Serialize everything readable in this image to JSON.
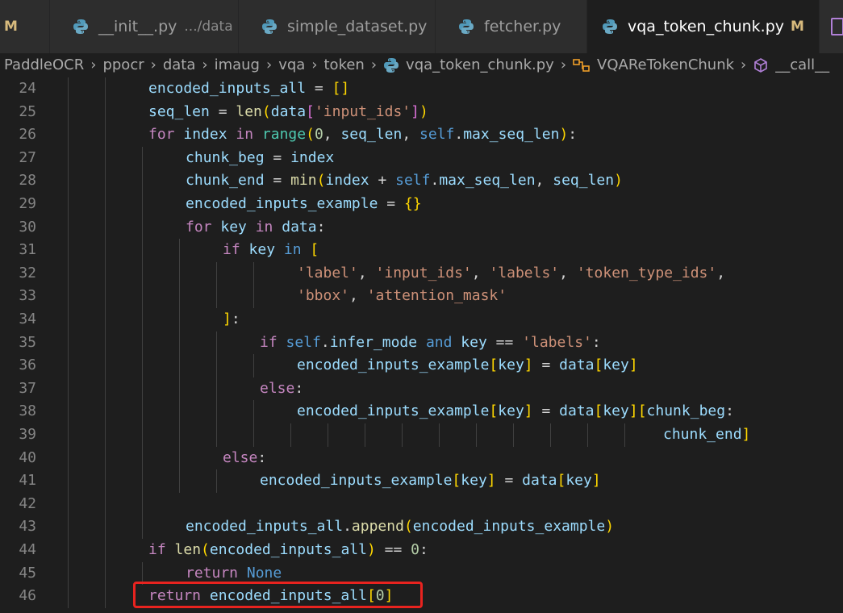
{
  "tabs": [
    {
      "label": "",
      "modified": "M",
      "active": false,
      "kind": "partial"
    },
    {
      "label": "__init__.py",
      "description": ".../data",
      "active": false,
      "kind": "python"
    },
    {
      "label": "simple_dataset.py",
      "active": false,
      "kind": "python"
    },
    {
      "label": "fetcher.py",
      "active": false,
      "kind": "python"
    },
    {
      "label": "vqa_token_chunk.py",
      "modified": "M",
      "active": true,
      "kind": "python"
    },
    {
      "label": "",
      "active": false,
      "kind": "preview"
    }
  ],
  "icons": {
    "python": "python-file-icon",
    "class": "class-symbol-icon",
    "method": "method-symbol-icon",
    "close": "close-icon",
    "chevron": "chevron-right-icon",
    "close_glyph": "✕",
    "chevron_glyph": "›"
  },
  "colors": {
    "highlight_box": "#e8231f",
    "accent_modified": "#d7ba7d"
  },
  "breadcrumb": [
    {
      "label": "PaddleOCR"
    },
    {
      "label": "ppocr"
    },
    {
      "label": "data"
    },
    {
      "label": "imaug"
    },
    {
      "label": "vqa"
    },
    {
      "label": "token"
    },
    {
      "label": "vqa_token_chunk.py",
      "icon": "python"
    },
    {
      "label": "VQAReTokenChunk",
      "icon": "class"
    },
    {
      "label": "__call__",
      "icon": "method"
    }
  ],
  "editor": {
    "lines": [
      {
        "n": "24",
        "indent": 2,
        "tokens": [
          [
            "c0",
            "encoded_inputs_all"
          ],
          [
            "op",
            " = "
          ],
          [
            "b1",
            "[]"
          ]
        ]
      },
      {
        "n": "25",
        "indent": 2,
        "tokens": [
          [
            "c0",
            "seq_len"
          ],
          [
            "op",
            " = "
          ],
          [
            "fn",
            "len"
          ],
          [
            "b1",
            "("
          ],
          [
            "c0",
            "data"
          ],
          [
            "b2",
            "["
          ],
          [
            "str",
            "'input_ids'"
          ],
          [
            "b2",
            "]"
          ],
          [
            "b1",
            ")"
          ]
        ]
      },
      {
        "n": "26",
        "indent": 2,
        "tokens": [
          [
            "kw",
            "for"
          ],
          [
            "c0",
            " index "
          ],
          [
            "kw",
            "in"
          ],
          [
            "op",
            " "
          ],
          [
            "cls",
            "range"
          ],
          [
            "b1",
            "("
          ],
          [
            "num",
            "0"
          ],
          [
            "op",
            ", "
          ],
          [
            "c0",
            "seq_len"
          ],
          [
            "op",
            ", "
          ],
          [
            "kwb",
            "self"
          ],
          [
            "op",
            "."
          ],
          [
            "c0",
            "max_seq_len"
          ],
          [
            "b1",
            ")"
          ],
          [
            "op",
            ":"
          ]
        ]
      },
      {
        "n": "27",
        "indent": 3,
        "tokens": [
          [
            "c0",
            "chunk_beg"
          ],
          [
            "op",
            " = "
          ],
          [
            "c0",
            "index"
          ]
        ]
      },
      {
        "n": "28",
        "indent": 3,
        "tokens": [
          [
            "c0",
            "chunk_end"
          ],
          [
            "op",
            " = "
          ],
          [
            "fn",
            "min"
          ],
          [
            "b1",
            "("
          ],
          [
            "c0",
            "index"
          ],
          [
            "op",
            " + "
          ],
          [
            "kwb",
            "self"
          ],
          [
            "op",
            "."
          ],
          [
            "c0",
            "max_seq_len"
          ],
          [
            "op",
            ", "
          ],
          [
            "c0",
            "seq_len"
          ],
          [
            "b1",
            ")"
          ]
        ]
      },
      {
        "n": "29",
        "indent": 3,
        "tokens": [
          [
            "c0",
            "encoded_inputs_example"
          ],
          [
            "op",
            " = "
          ],
          [
            "b1",
            "{}"
          ]
        ]
      },
      {
        "n": "30",
        "indent": 3,
        "tokens": [
          [
            "kw",
            "for"
          ],
          [
            "c0",
            " key "
          ],
          [
            "kw",
            "in"
          ],
          [
            "c0",
            " data"
          ],
          [
            "op",
            ":"
          ]
        ]
      },
      {
        "n": "31",
        "indent": 4,
        "tokens": [
          [
            "kw",
            "if"
          ],
          [
            "c0",
            " key "
          ],
          [
            "kwb",
            "in"
          ],
          [
            "op",
            " "
          ],
          [
            "b1",
            "["
          ]
        ]
      },
      {
        "n": "32",
        "indent": 6,
        "tokens": [
          [
            "str",
            "'label'"
          ],
          [
            "op",
            ", "
          ],
          [
            "str",
            "'input_ids'"
          ],
          [
            "op",
            ", "
          ],
          [
            "str",
            "'labels'"
          ],
          [
            "op",
            ", "
          ],
          [
            "str",
            "'token_type_ids'"
          ],
          [
            "op",
            ","
          ]
        ]
      },
      {
        "n": "33",
        "indent": 6,
        "tokens": [
          [
            "str",
            "'bbox'"
          ],
          [
            "op",
            ", "
          ],
          [
            "str",
            "'attention_mask'"
          ]
        ]
      },
      {
        "n": "34",
        "indent": 4,
        "tokens": [
          [
            "b1",
            "]"
          ],
          [
            "op",
            ":"
          ]
        ]
      },
      {
        "n": "35",
        "indent": 5,
        "tokens": [
          [
            "kw",
            "if"
          ],
          [
            "op",
            " "
          ],
          [
            "kwb",
            "self"
          ],
          [
            "op",
            "."
          ],
          [
            "c0",
            "infer_mode "
          ],
          [
            "kwb",
            "and"
          ],
          [
            "c0",
            " key "
          ],
          [
            "op",
            "== "
          ],
          [
            "str",
            "'labels'"
          ],
          [
            "op",
            ":"
          ]
        ]
      },
      {
        "n": "36",
        "indent": 6,
        "tokens": [
          [
            "c0",
            "encoded_inputs_example"
          ],
          [
            "b1",
            "["
          ],
          [
            "c0",
            "key"
          ],
          [
            "b1",
            "]"
          ],
          [
            "op",
            " = "
          ],
          [
            "c0",
            "data"
          ],
          [
            "b1",
            "["
          ],
          [
            "c0",
            "key"
          ],
          [
            "b1",
            "]"
          ]
        ]
      },
      {
        "n": "37",
        "indent": 5,
        "tokens": [
          [
            "kw",
            "else"
          ],
          [
            "op",
            ":"
          ]
        ]
      },
      {
        "n": "38",
        "indent": 6,
        "tokens": [
          [
            "c0",
            "encoded_inputs_example"
          ],
          [
            "b1",
            "["
          ],
          [
            "c0",
            "key"
          ],
          [
            "b1",
            "]"
          ],
          [
            "op",
            " = "
          ],
          [
            "c0",
            "data"
          ],
          [
            "b1",
            "["
          ],
          [
            "c0",
            "key"
          ],
          [
            "b1",
            "]"
          ],
          [
            "b1",
            "["
          ],
          [
            "c0",
            "chunk_beg"
          ],
          [
            "op",
            ":"
          ]
        ]
      },
      {
        "n": "39",
        "indent": 16,
        "tokens": [
          [
            "c0",
            "chunk_end"
          ],
          [
            "b1",
            "]"
          ]
        ]
      },
      {
        "n": "40",
        "indent": 4,
        "tokens": [
          [
            "kw",
            "else"
          ],
          [
            "op",
            ":"
          ]
        ]
      },
      {
        "n": "41",
        "indent": 5,
        "tokens": [
          [
            "c0",
            "encoded_inputs_example"
          ],
          [
            "b1",
            "["
          ],
          [
            "c0",
            "key"
          ],
          [
            "b1",
            "]"
          ],
          [
            "op",
            " = "
          ],
          [
            "c0",
            "data"
          ],
          [
            "b1",
            "["
          ],
          [
            "c0",
            "key"
          ],
          [
            "b1",
            "]"
          ]
        ]
      },
      {
        "n": "42",
        "indent": 0,
        "tokens": []
      },
      {
        "n": "43",
        "indent": 3,
        "tokens": [
          [
            "c0",
            "encoded_inputs_all"
          ],
          [
            "op",
            "."
          ],
          [
            "fn",
            "append"
          ],
          [
            "b1",
            "("
          ],
          [
            "c0",
            "encoded_inputs_example"
          ],
          [
            "b1",
            ")"
          ]
        ]
      },
      {
        "n": "44",
        "indent": 2,
        "tokens": [
          [
            "kw",
            "if"
          ],
          [
            "op",
            " "
          ],
          [
            "fn",
            "len"
          ],
          [
            "b1",
            "("
          ],
          [
            "c0",
            "encoded_inputs_all"
          ],
          [
            "b1",
            ")"
          ],
          [
            "op",
            " == "
          ],
          [
            "num",
            "0"
          ],
          [
            "op",
            ":"
          ]
        ]
      },
      {
        "n": "45",
        "indent": 3,
        "tokens": [
          [
            "kw",
            "return"
          ],
          [
            "op",
            " "
          ],
          [
            "kwb",
            "None"
          ]
        ]
      },
      {
        "n": "46",
        "indent": 2,
        "tokens": [
          [
            "kw",
            "return"
          ],
          [
            "c0",
            " encoded_inputs_all"
          ],
          [
            "b1",
            "["
          ],
          [
            "num",
            "0"
          ],
          [
            "b1",
            "]"
          ]
        ]
      }
    ]
  }
}
